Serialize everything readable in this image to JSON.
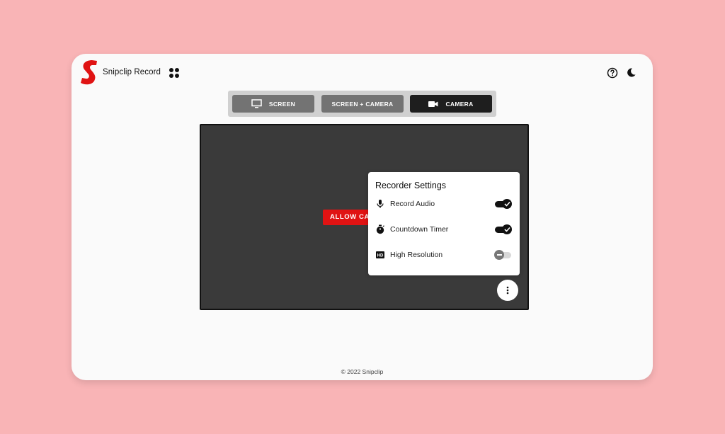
{
  "app": {
    "name": "Snipclip Record",
    "brand_color": "#e01313"
  },
  "header": {
    "icons": [
      "apps-icon",
      "help-icon",
      "moon-icon"
    ]
  },
  "mode_tabs": [
    {
      "label": "SCREEN",
      "icon": "monitor-icon",
      "selected": false
    },
    {
      "label": "SCREEN + CAMERA",
      "icon": "",
      "selected": false
    },
    {
      "label": "CAMERA",
      "icon": "video-camera-icon",
      "selected": true
    }
  ],
  "preview": {
    "allow_button": "ALLOW CAMERA"
  },
  "settings": {
    "title": "Recorder Settings",
    "items": [
      {
        "label": "Record Audio",
        "icon": "microphone-icon",
        "enabled": true
      },
      {
        "label": "Countdown Timer",
        "icon": "timer-icon",
        "enabled": true
      },
      {
        "label": "High Resolution",
        "icon": "hd-icon",
        "enabled": false
      }
    ]
  },
  "footer": {
    "text": "© 2022 Snipclip"
  }
}
